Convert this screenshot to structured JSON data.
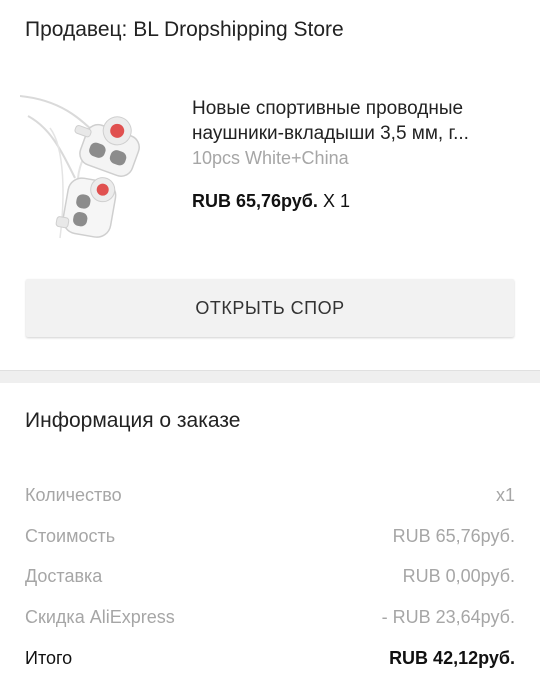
{
  "seller": {
    "label": "Продавец: BL Dropshipping Store"
  },
  "product": {
    "image": "white-earphones-image",
    "title": "Новые спортивные проводные наушники-вкладыши 3,5 мм, г...",
    "variant": "10pcs White+China",
    "price": "RUB 65,76руб.",
    "quantity": "X 1"
  },
  "dispute_button": {
    "label": "ОТКРЫТЬ СПОР"
  },
  "order_info": {
    "title": "Информация о заказе",
    "rows": [
      {
        "label": "Количество",
        "value": "x1"
      },
      {
        "label": "Стоимость",
        "value": "RUB 65,76руб."
      },
      {
        "label": "Доставка",
        "value": "RUB 0,00руб."
      },
      {
        "label": "Скидка AliExpress",
        "value": "- RUB 23,64руб."
      },
      {
        "label": "Итого",
        "value": "RUB 42,12руб."
      }
    ]
  },
  "colors": {
    "background": "#ffffff",
    "muted_text": "#a6a6a6",
    "button_bg": "#f2f2f2",
    "divider": "#efefef",
    "earbud_accent": "#e0504f"
  }
}
